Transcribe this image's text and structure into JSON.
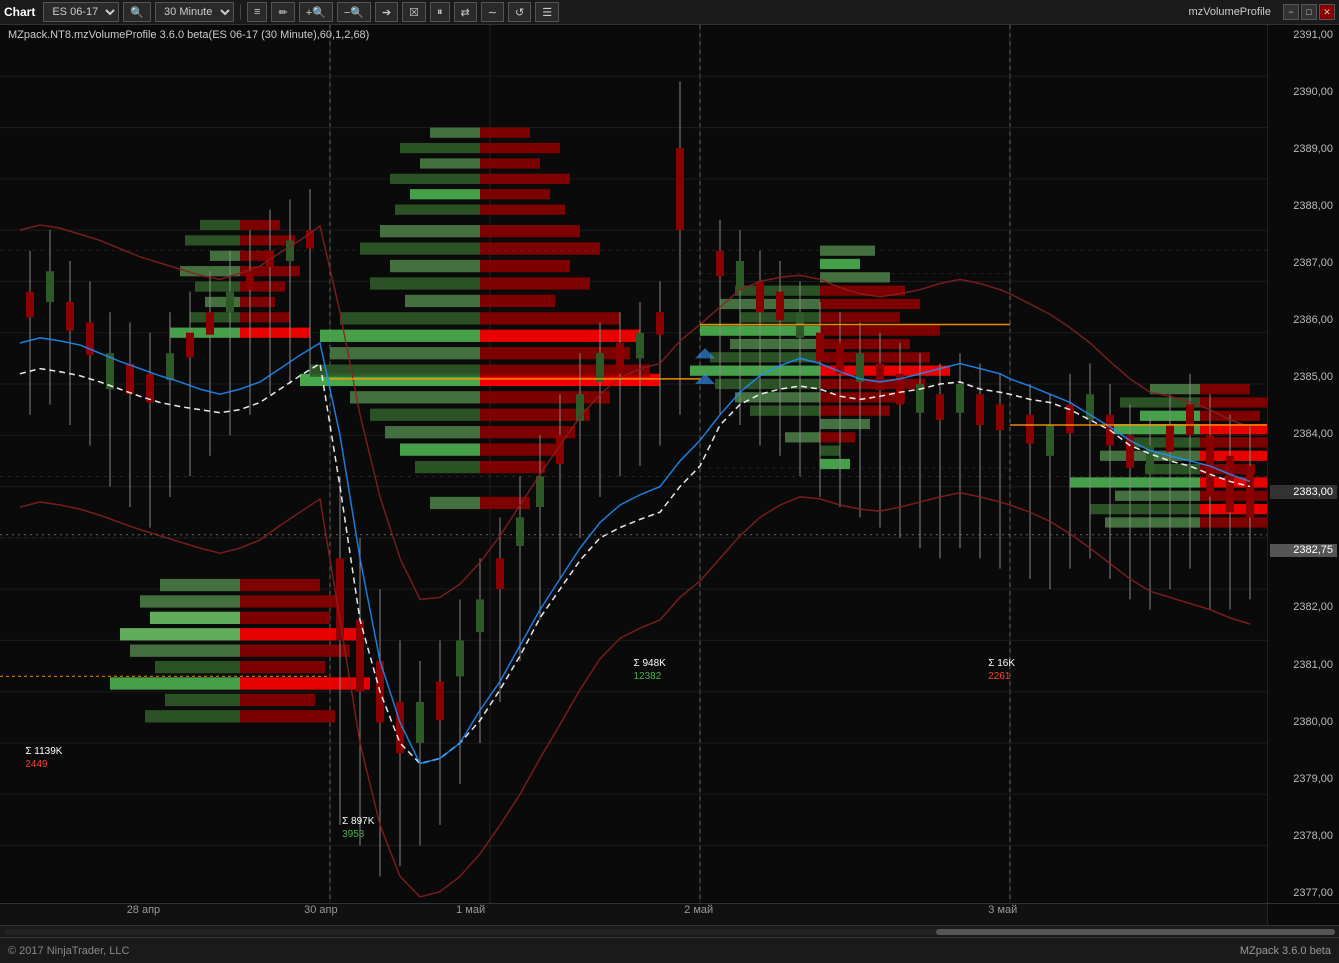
{
  "titlebar": {
    "title": "Chart",
    "instrument": "ES 06-17",
    "timeframe": "30 Minute",
    "window_title": "mzVolumeProfile",
    "tools": [
      "bar-chart-icon",
      "pencil-icon",
      "zoom-in-icon",
      "zoom-out-icon",
      "arrow-icon",
      "properties-icon",
      "play-pause-icon",
      "arrows-icon",
      "wave-icon",
      "refresh-icon",
      "menu-icon"
    ],
    "win_controls": [
      "minimize",
      "maximize",
      "close"
    ]
  },
  "chart": {
    "indicator_label": "MZpack.NT8.mzVolumeProfile 3.6.0 beta(ES 06-17 (30 Minute),60,1,2,68)",
    "price_levels": [
      "2391,00",
      "2390,00",
      "2389,00",
      "2388,00",
      "2387,00",
      "2386,00",
      "2385,00",
      "2384,00",
      "2383,00",
      "2382,75",
      "2382,00",
      "2381,00",
      "2380,00",
      "2379,00",
      "2378,00",
      "2377,00"
    ],
    "current_price": "2382,75",
    "date_labels": [
      {
        "text": "28 апр",
        "left": "12%"
      },
      {
        "text": "30 апр",
        "left": "26%"
      },
      {
        "text": "1 май",
        "left": "38%"
      },
      {
        "text": "2 май",
        "left": "57%"
      },
      {
        "text": "3 май",
        "left": "80%"
      }
    ],
    "stats": [
      {
        "id": "stat1",
        "line1": "Σ 1139K",
        "line2": "2449",
        "left": "2%",
        "top": "82%",
        "color2": "red"
      },
      {
        "id": "stat2",
        "line1": "Σ 897K",
        "line2": "3953",
        "left": "27%",
        "top": "90%",
        "color2": "green"
      },
      {
        "id": "stat3",
        "line1": "Σ 948K",
        "line2": "12382",
        "left": "50%",
        "top": "72%",
        "color2": "green"
      },
      {
        "id": "stat4",
        "line1": "Σ 16K",
        "line2": "2261",
        "left": "78%",
        "top": "72%",
        "color2": "red"
      }
    ]
  },
  "footer": {
    "copyright": "© 2017 NinjaTrader, LLC",
    "version": "MZpack 3.6.0 beta"
  }
}
